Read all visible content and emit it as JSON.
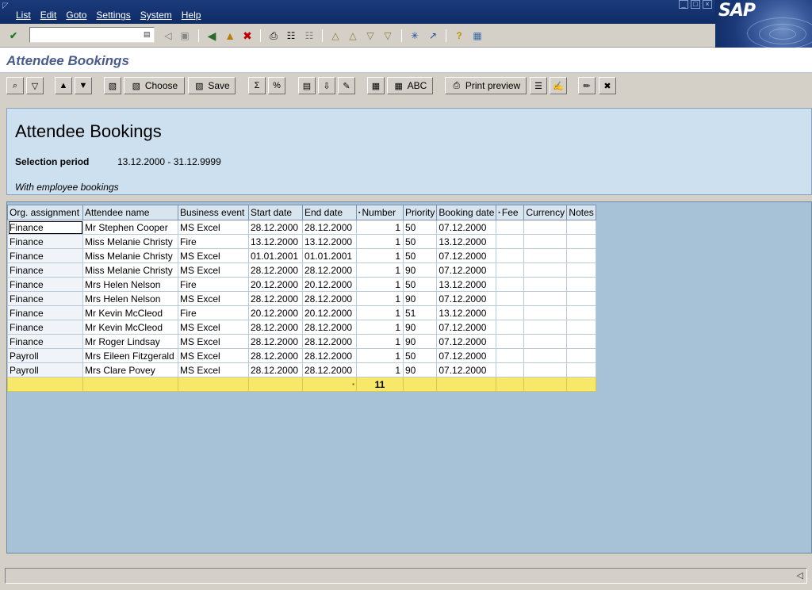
{
  "menubar": {
    "items": [
      "List",
      "Edit",
      "Goto",
      "Settings",
      "System",
      "Help"
    ]
  },
  "logo": {
    "text": "SAP"
  },
  "command_field": {
    "value": ""
  },
  "title": "Attendee Bookings",
  "app_toolbar": {
    "choose_label": "Choose",
    "save_label": "Save",
    "abc_label": "ABC",
    "print_preview_label": "Print preview"
  },
  "header": {
    "title": "Attendee Bookings",
    "selection_label": "Selection period",
    "selection_value": "13.12.2000 - 31.12.9999",
    "note": "With employee bookings"
  },
  "table": {
    "columns": [
      "Org. assignment",
      "Attendee name",
      "Business event",
      "Start date",
      "End date",
      "Number",
      "Priority",
      "Booking date",
      "Fee",
      "Currency",
      "Notes"
    ],
    "rows": [
      [
        "Finance",
        "Mr Stephen Cooper",
        "MS Excel",
        "28.12.2000",
        "28.12.2000",
        "1",
        "50",
        "07.12.2000",
        "",
        "",
        ""
      ],
      [
        "Finance",
        "Miss Melanie Christy",
        "Fire",
        "13.12.2000",
        "13.12.2000",
        "1",
        "50",
        "13.12.2000",
        "",
        "",
        ""
      ],
      [
        "Finance",
        "Miss Melanie Christy",
        "MS Excel",
        "01.01.2001",
        "01.01.2001",
        "1",
        "50",
        "07.12.2000",
        "",
        "",
        ""
      ],
      [
        "Finance",
        "Miss Melanie Christy",
        "MS Excel",
        "28.12.2000",
        "28.12.2000",
        "1",
        "90",
        "07.12.2000",
        "",
        "",
        ""
      ],
      [
        "Finance",
        "Mrs Helen Nelson",
        "Fire",
        "20.12.2000",
        "20.12.2000",
        "1",
        "50",
        "13.12.2000",
        "",
        "",
        ""
      ],
      [
        "Finance",
        "Mrs Helen Nelson",
        "MS Excel",
        "28.12.2000",
        "28.12.2000",
        "1",
        "90",
        "07.12.2000",
        "",
        "",
        ""
      ],
      [
        "Finance",
        "Mr Kevin McCleod",
        "Fire",
        "20.12.2000",
        "20.12.2000",
        "1",
        "51",
        "13.12.2000",
        "",
        "",
        ""
      ],
      [
        "Finance",
        "Mr Kevin McCleod",
        "MS Excel",
        "28.12.2000",
        "28.12.2000",
        "1",
        "90",
        "07.12.2000",
        "",
        "",
        ""
      ],
      [
        "Finance",
        "Mr Roger Lindsay",
        "MS Excel",
        "28.12.2000",
        "28.12.2000",
        "1",
        "90",
        "07.12.2000",
        "",
        "",
        ""
      ],
      [
        "Payroll",
        "Mrs Eileen Fitzgerald",
        "MS Excel",
        "28.12.2000",
        "28.12.2000",
        "1",
        "50",
        "07.12.2000",
        "",
        "",
        ""
      ],
      [
        "Payroll",
        "Mrs Clare Povey",
        "MS Excel",
        "28.12.2000",
        "28.12.2000",
        "1",
        "90",
        "07.12.2000",
        "",
        "",
        ""
      ]
    ],
    "total": {
      "marker": "▪",
      "value": "11"
    }
  },
  "status": {
    "text": ""
  },
  "colors": {
    "menubar": "#0f2c66",
    "title_text": "#4a5c8c",
    "header_panel": "#cde0ef",
    "grid_background": "#a7c2d6",
    "total_row": "#f8e86a"
  }
}
